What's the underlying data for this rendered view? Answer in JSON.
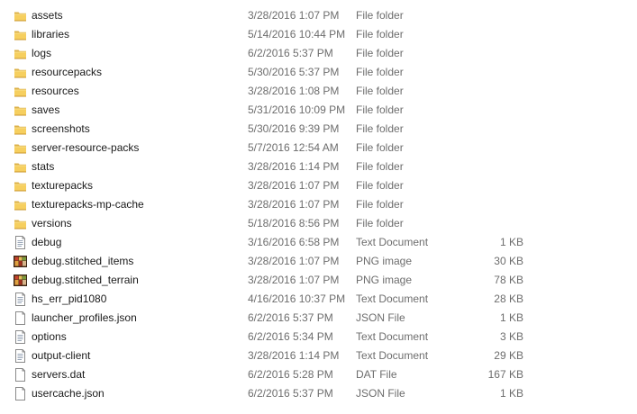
{
  "files": [
    {
      "name": "assets",
      "date": "3/28/2016 1:07 PM",
      "type": "File folder",
      "size": "",
      "icon": "folder-icon"
    },
    {
      "name": "libraries",
      "date": "5/14/2016 10:44 PM",
      "type": "File folder",
      "size": "",
      "icon": "folder-icon"
    },
    {
      "name": "logs",
      "date": "6/2/2016 5:37 PM",
      "type": "File folder",
      "size": "",
      "icon": "folder-icon"
    },
    {
      "name": "resourcepacks",
      "date": "5/30/2016 5:37 PM",
      "type": "File folder",
      "size": "",
      "icon": "folder-icon"
    },
    {
      "name": "resources",
      "date": "3/28/2016 1:08 PM",
      "type": "File folder",
      "size": "",
      "icon": "folder-icon"
    },
    {
      "name": "saves",
      "date": "5/31/2016 10:09 PM",
      "type": "File folder",
      "size": "",
      "icon": "folder-icon"
    },
    {
      "name": "screenshots",
      "date": "5/30/2016 9:39 PM",
      "type": "File folder",
      "size": "",
      "icon": "folder-icon"
    },
    {
      "name": "server-resource-packs",
      "date": "5/7/2016 12:54 AM",
      "type": "File folder",
      "size": "",
      "icon": "folder-icon"
    },
    {
      "name": "stats",
      "date": "3/28/2016 1:14 PM",
      "type": "File folder",
      "size": "",
      "icon": "folder-icon"
    },
    {
      "name": "texturepacks",
      "date": "3/28/2016 1:07 PM",
      "type": "File folder",
      "size": "",
      "icon": "folder-icon"
    },
    {
      "name": "texturepacks-mp-cache",
      "date": "3/28/2016 1:07 PM",
      "type": "File folder",
      "size": "",
      "icon": "folder-icon"
    },
    {
      "name": "versions",
      "date": "5/18/2016 8:56 PM",
      "type": "File folder",
      "size": "",
      "icon": "folder-icon"
    },
    {
      "name": "debug",
      "date": "3/16/2016 6:58 PM",
      "type": "Text Document",
      "size": "1 KB",
      "icon": "text-document-icon"
    },
    {
      "name": "debug.stitched_items",
      "date": "3/28/2016 1:07 PM",
      "type": "PNG image",
      "size": "30 KB",
      "icon": "png-image-icon"
    },
    {
      "name": "debug.stitched_terrain",
      "date": "3/28/2016 1:07 PM",
      "type": "PNG image",
      "size": "78 KB",
      "icon": "png-image-icon"
    },
    {
      "name": "hs_err_pid1080",
      "date": "4/16/2016 10:37 PM",
      "type": "Text Document",
      "size": "28 KB",
      "icon": "text-document-icon"
    },
    {
      "name": "launcher_profiles.json",
      "date": "6/2/2016 5:37 PM",
      "type": "JSON File",
      "size": "1 KB",
      "icon": "generic-file-icon"
    },
    {
      "name": "options",
      "date": "6/2/2016 5:34 PM",
      "type": "Text Document",
      "size": "3 KB",
      "icon": "text-document-icon"
    },
    {
      "name": "output-client",
      "date": "3/28/2016 1:14 PM",
      "type": "Text Document",
      "size": "29 KB",
      "icon": "text-document-icon"
    },
    {
      "name": "servers.dat",
      "date": "6/2/2016 5:28 PM",
      "type": "DAT File",
      "size": "167 KB",
      "icon": "generic-file-icon"
    },
    {
      "name": "usercache.json",
      "date": "6/2/2016 5:37 PM",
      "type": "JSON File",
      "size": "1 KB",
      "icon": "generic-file-icon"
    }
  ]
}
